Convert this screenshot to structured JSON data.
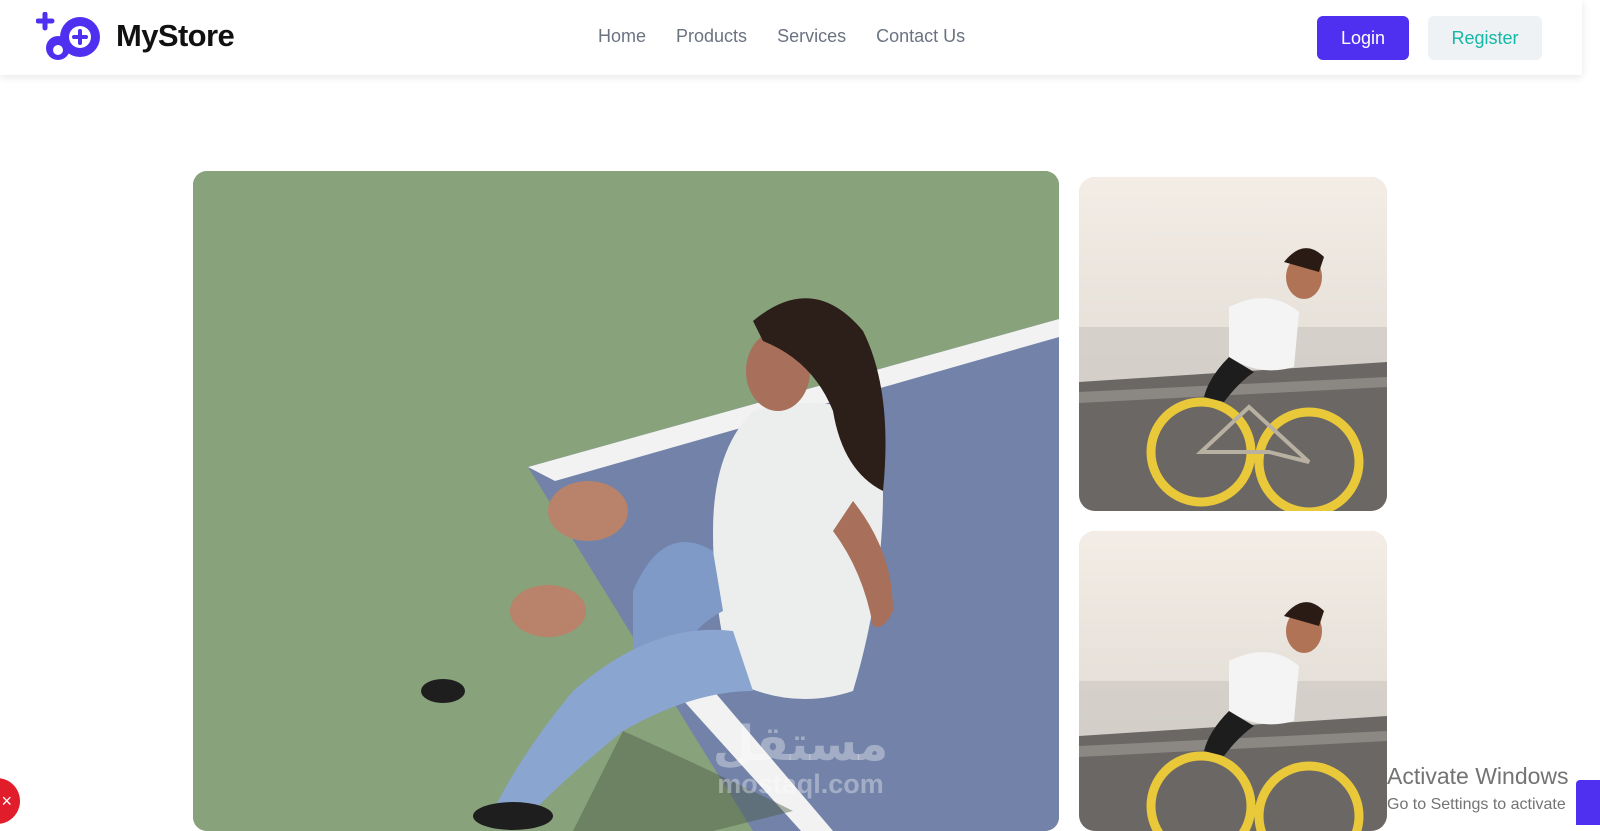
{
  "brand": {
    "name": "MyStore"
  },
  "nav": {
    "items": [
      "Home",
      "Products",
      "Services",
      "Contact Us"
    ]
  },
  "auth": {
    "login_label": "Login",
    "register_label": "Register"
  },
  "watermark": {
    "arabic": "مستقل",
    "latin": "mostaql.com"
  },
  "os_notice": {
    "title": "Activate Windows",
    "subtitle": "Go to Settings to activate"
  },
  "widget": {
    "close_glyph": "×"
  },
  "colors": {
    "primary": "#4f2ff0",
    "register_text": "#14b8a6",
    "nav_text": "#6b7280"
  }
}
